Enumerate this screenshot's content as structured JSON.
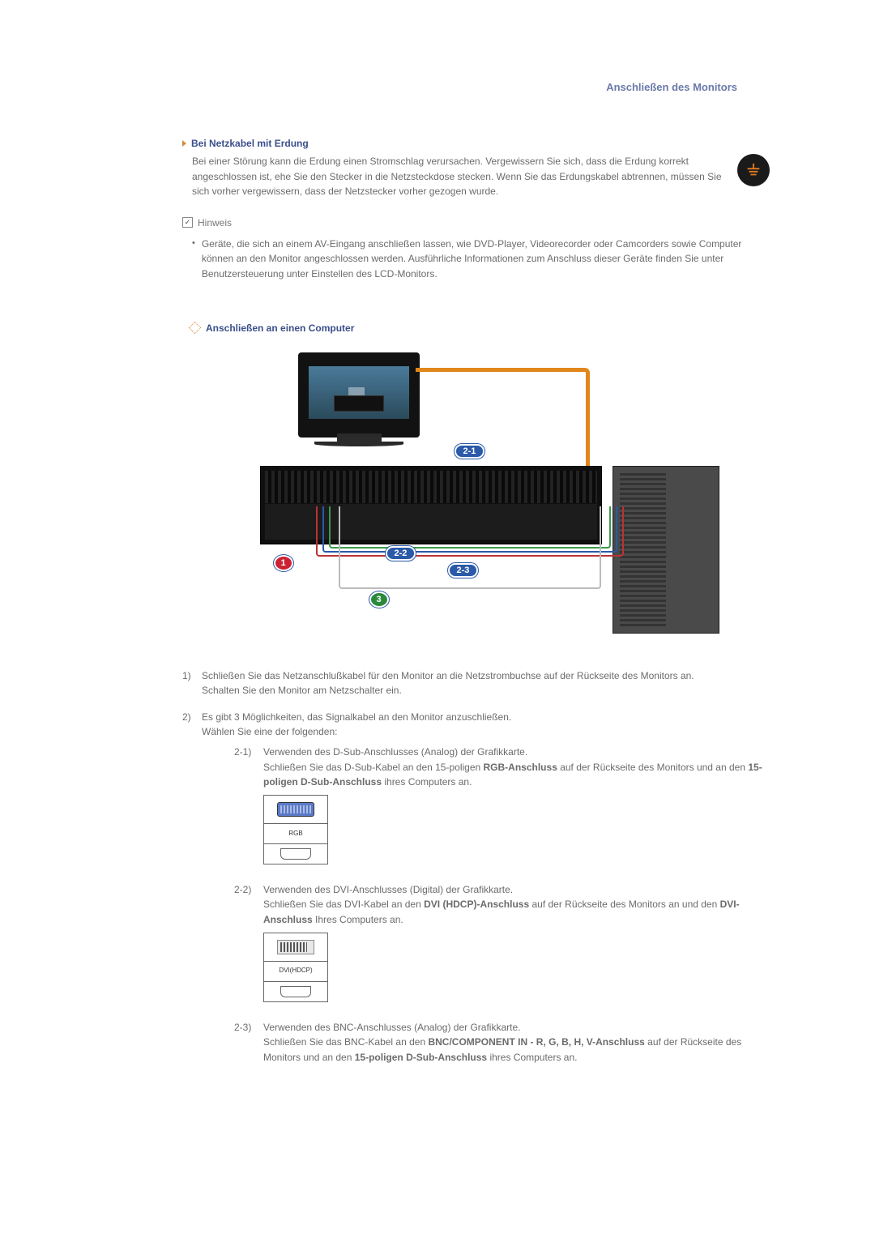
{
  "page_title": "Anschließen des Monitors",
  "section1": {
    "heading": "Bei Netzkabel mit Erdung",
    "body": "Bei einer Störung kann die Erdung einen Stromschlag verursachen. Vergewissern Sie sich, dass die Erdung korrekt angeschlossen ist, ehe Sie den Stecker in die Netzsteckdose stecken. Wenn Sie das Erdungskabel abtrennen, müssen Sie sich vorher vergewissern, dass der Netzstecker vorher gezogen wurde."
  },
  "note": {
    "label": "Hinweis",
    "body": "Geräte, die sich an einem AV-Eingang anschließen lassen, wie DVD-Player, Videorecorder oder Camcorders sowie Computer können an den Monitor angeschlossen werden. Ausführliche Informationen zum Anschluss dieser Geräte finden Sie unter Benutzersteuerung unter Einstellen des LCD-Monitors."
  },
  "section2_heading": "Anschließen an einen Computer",
  "badges": {
    "b21": "2-1",
    "b22": "2-2",
    "b23": "2-3",
    "r1": "1",
    "g3": "3"
  },
  "list": {
    "i1": {
      "num": "1)",
      "line_a": "Schließen Sie das Netzanschlußkabel für den Monitor an die Netzstrombuchse auf der Rückseite des Monitors an.",
      "line_b": "Schalten Sie den Monitor am Netzschalter ein."
    },
    "i2": {
      "num": "2)",
      "line_a": "Es gibt 3 Möglichkeiten, das Signalkabel an den Monitor anzuschließen.",
      "line_b": "Wählen Sie eine der folgenden:",
      "s21": {
        "num": "2-1)",
        "l1": "Verwenden des D-Sub-Anschlusses (Analog) der Grafikkarte.",
        "l2a": "Schließen Sie das D-Sub-Kabel an den 15-poligen ",
        "l2b": "RGB-Anschluss",
        "l2c": " auf der Rückseite des Monitors und an den ",
        "l2d": "15-poligen D-Sub-Anschluss",
        "l2e": " ihres Computers an.",
        "port_label": "RGB"
      },
      "s22": {
        "num": "2-2)",
        "l1": "Verwenden des DVI-Anschlusses (Digital) der Grafikkarte.",
        "l2a": "Schließen Sie das DVI-Kabel an den ",
        "l2b": "DVI (HDCP)-Anschluss",
        "l2c": " auf der Rückseite des Monitors an und den ",
        "l2d": "DVI-Anschluss",
        "l2e": " Ihres Computers an.",
        "port_label": "DVI(HDCP)"
      },
      "s23": {
        "num": "2-3)",
        "l1": "Verwenden des BNC-Anschlusses (Analog) der Grafikkarte.",
        "l2a": "Schließen Sie das BNC-Kabel an den ",
        "l2b": "BNC/COMPONENT IN - R, G, B, H, V-Anschluss",
        "l2c": " auf der Rückseite des Monitors und an den ",
        "l2d": "15-poligen D-Sub-Anschluss",
        "l2e": " ihres Computers an."
      }
    }
  }
}
